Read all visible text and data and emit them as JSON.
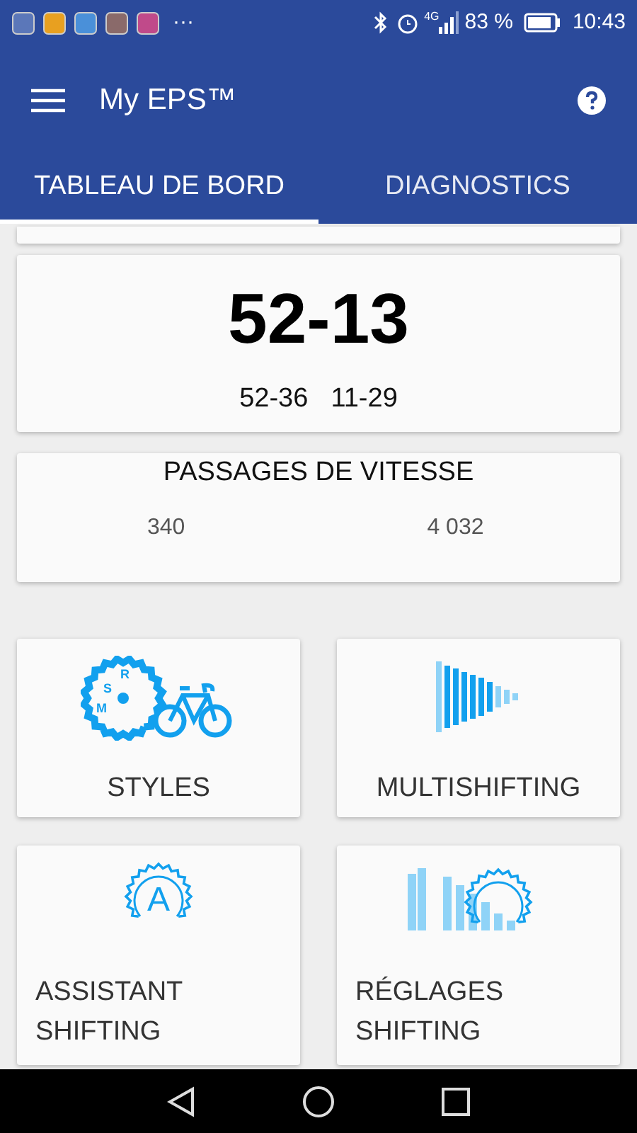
{
  "status_bar": {
    "notification_more": "···",
    "battery": "83 %",
    "time": "10:43",
    "network": "4G"
  },
  "app_bar": {
    "title": "My EPS™"
  },
  "tabs": [
    {
      "label": "TABLEAU DE BORD",
      "selected": true
    },
    {
      "label": "DIAGNOSTICS",
      "selected": false
    }
  ],
  "gear_card": {
    "current": "52-13",
    "chainrings": "52-36",
    "cassette": "11-29"
  },
  "shifts_card": {
    "title": "PASSAGES DE VITESSE",
    "value_1": "340",
    "value_2": "4 032"
  },
  "tiles": [
    {
      "kind": "styles",
      "label": "STYLES",
      "icon_letters": [
        "S",
        "R",
        "M"
      ]
    },
    {
      "kind": "multishifting",
      "label": "MULTISHIFTING"
    },
    {
      "kind": "assistant",
      "label": "ASSISTANT SHIFTING",
      "icon_letters": [
        "A"
      ]
    },
    {
      "kind": "settings",
      "label": "RÉGLAGES SHIFTING"
    }
  ]
}
